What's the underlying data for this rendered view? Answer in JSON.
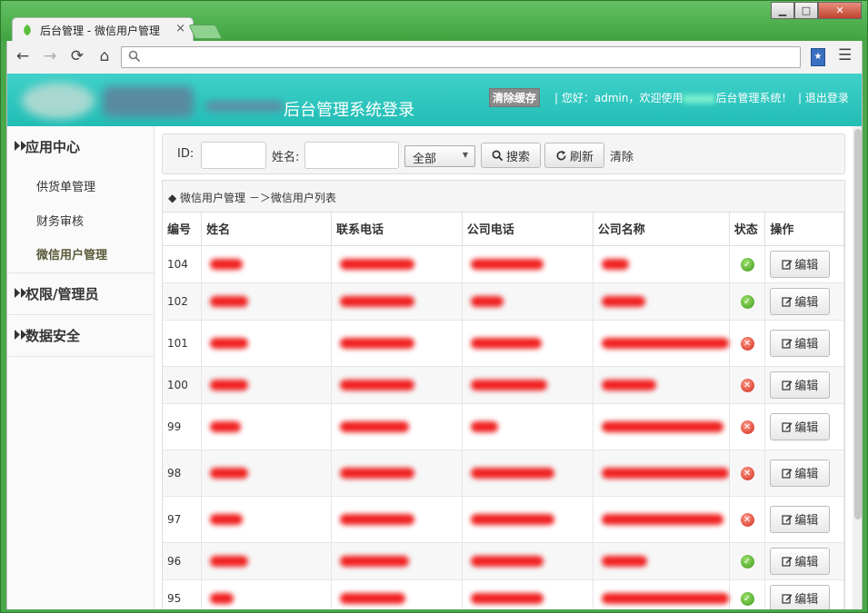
{
  "browser": {
    "tab_title": "后台管理 - 微信用户管理",
    "tab_close": "×",
    "window_controls": {
      "minimize": "▁",
      "maximize": "□",
      "close": "✕"
    },
    "nav": {
      "back": "←",
      "forward": "→",
      "reload": "⟳",
      "home": "⌂"
    },
    "omnibox_value": ""
  },
  "header": {
    "system_title": "后台管理系统登录",
    "clear_cache_label": "清除缓存",
    "welcome_prefix": "| 您好：admin，欢迎使用",
    "welcome_suffix": "后台管理系统！",
    "logout_label": "| 退出登录"
  },
  "sidebar": {
    "groups": [
      {
        "title": "应用中心"
      },
      {
        "title": "权限/管理员"
      },
      {
        "title": "数据安全"
      }
    ],
    "items": [
      {
        "label": "供货单管理"
      },
      {
        "label": "财务审核"
      },
      {
        "label": "微信用户管理",
        "active": true
      }
    ]
  },
  "search": {
    "id_label": "ID:",
    "id_value": "",
    "name_label": "姓名:",
    "name_value": "",
    "status_selected": "全部",
    "search_button": "搜索",
    "refresh_button": "刷新",
    "clear_link": "清除"
  },
  "breadcrumb": "◆ 微信用户管理 －＞微信用户列表",
  "table": {
    "headers": [
      "编号",
      "姓名",
      "联系电话",
      "公司电话",
      "公司名称",
      "状态",
      "操作"
    ],
    "edit_label": "编辑",
    "rows": [
      {
        "id": "104",
        "status": "ok"
      },
      {
        "id": "102",
        "status": "ok"
      },
      {
        "id": "101",
        "status": "no"
      },
      {
        "id": "100",
        "status": "no"
      },
      {
        "id": "99",
        "status": "no"
      },
      {
        "id": "98",
        "status": "no"
      },
      {
        "id": "97",
        "status": "no"
      },
      {
        "id": "96",
        "status": "ok"
      },
      {
        "id": "95",
        "status": "ok"
      }
    ]
  },
  "colors": {
    "header_teal": "#22bdb5",
    "status_ok": "#3e9a1c",
    "status_error": "#d02818",
    "redaction": "#f02020"
  }
}
